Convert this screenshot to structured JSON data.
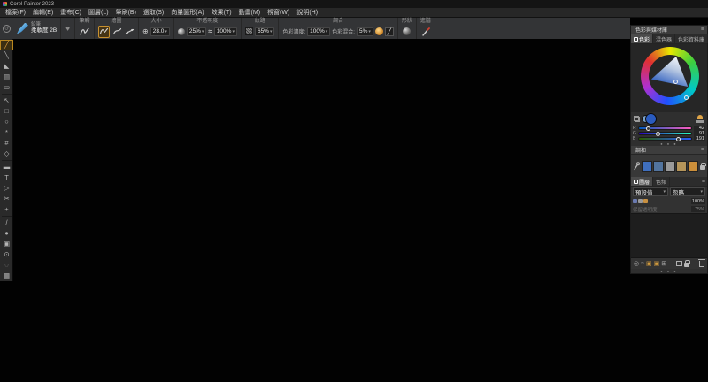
{
  "window": {
    "title": "Corel Painter 2023"
  },
  "menu": {
    "items": [
      "檔案(F)",
      "編輯(E)",
      "畫布(C)",
      "圖層(L)",
      "筆刷(B)",
      "選取(S)",
      "向量圖形(A)",
      "效果(T)",
      "動畫(M)",
      "視窗(W)",
      "說明(H)"
    ]
  },
  "property_bar": {
    "brush_selector": {
      "category": "鉛筆",
      "variant": "柔軟度 2B"
    },
    "stroke_group": {
      "label": "筆觸"
    },
    "draw_group": {
      "label": "繪圖"
    },
    "size_group": {
      "label": "大小",
      "value": "28.0"
    },
    "opacity_group": {
      "label": "不透明度",
      "value": "25%",
      "expression_value": "100%"
    },
    "grain_group": {
      "label": "紋路",
      "value": "65%"
    },
    "blend_group": {
      "label": "調合",
      "resat_label": "色彩濃度:",
      "resat_value": "100%",
      "bleed_label": "色彩混合:",
      "bleed_value": "5%"
    },
    "shape_group": {
      "label": "形狀"
    },
    "advanced_group": {
      "label": "進階"
    }
  },
  "toolbox": {
    "tools": [
      {
        "name": "brush",
        "glyph": "╱",
        "selected": true
      },
      {
        "name": "pen",
        "glyph": "╲"
      },
      {
        "name": "paint-bucket",
        "glyph": "◣"
      },
      {
        "name": "gradient",
        "glyph": "▤"
      },
      {
        "name": "eraser",
        "glyph": "▭"
      },
      {
        "divider": true
      },
      {
        "name": "layer-adjuster",
        "glyph": "↖"
      },
      {
        "name": "rect-select",
        "glyph": "□"
      },
      {
        "name": "lasso",
        "glyph": "○"
      },
      {
        "name": "magic-wand",
        "glyph": "*"
      },
      {
        "name": "crop",
        "glyph": "#"
      },
      {
        "name": "transform",
        "glyph": "◇"
      },
      {
        "divider": true
      },
      {
        "name": "shape-rect",
        "glyph": "▬"
      },
      {
        "name": "text",
        "glyph": "T"
      },
      {
        "name": "shape-selection",
        "glyph": "▷"
      },
      {
        "name": "scissors",
        "glyph": "✂"
      },
      {
        "name": "add-point",
        "glyph": "+"
      },
      {
        "divider": true
      },
      {
        "name": "eyedropper",
        "glyph": "/"
      },
      {
        "name": "dropper",
        "glyph": "●"
      },
      {
        "name": "clone",
        "glyph": "▣"
      },
      {
        "name": "magnifier",
        "glyph": "⊙"
      },
      {
        "name": "rotate-page",
        "glyph": "◌"
      },
      {
        "name": "navigator",
        "glyph": "▦"
      }
    ]
  },
  "dock": {
    "color_panel": {
      "header": "色彩與媒材庫",
      "tabs": [
        "色彩",
        "混色器",
        "色彩資料庫"
      ],
      "active_tab": "色彩",
      "main_color_hex": "#2a5bbf",
      "secondary_color_hex": "#7aa0c8",
      "sliders": [
        {
          "label": "R",
          "value": 42,
          "track_from": "#005bbf",
          "track_to": "#ff5bbf"
        },
        {
          "label": "G",
          "value": 91,
          "track_from": "#2a00bf",
          "track_to": "#2affbf"
        },
        {
          "label": "B",
          "value": 191,
          "track_from": "#2a5b00",
          "track_to": "#2a5bff"
        }
      ]
    },
    "harmonies_panel": {
      "header": "調和",
      "swatches": [
        "#3f6fbe",
        "#52749e",
        "#9a9a9a",
        "#b5955a",
        "#cc8f3a"
      ]
    },
    "layers_panel": {
      "tabs": [
        "圖層",
        "色頻"
      ],
      "active_tab": "圖層",
      "composite_method": "預設值",
      "composite_depth": "忽略",
      "opacity_value": "100%",
      "preserve_label": "保留透明度",
      "preserve_value": "75%",
      "bottom_icons": [
        {
          "name": "dynamic-plugins-icon",
          "glyph": "◎",
          "orange": false
        },
        {
          "name": "layer-commands-icon",
          "glyph": "≈",
          "orange": false
        },
        {
          "name": "new-watercolor-layer-icon",
          "glyph": "▣",
          "orange": true
        },
        {
          "name": "new-liquid-ink-layer-icon",
          "glyph": "▣",
          "orange": true
        },
        {
          "name": "group-layers-icon",
          "glyph": "⊞",
          "orange": false
        }
      ]
    }
  },
  "icons": {
    "heart": "♥",
    "hamburger": "≡",
    "caret": "▾",
    "size_glyph": "⊕",
    "expression_glyph": "≈",
    "stylus_glyph": "╱",
    "reset_glyph": "↺",
    "dots": "● ● ●"
  }
}
